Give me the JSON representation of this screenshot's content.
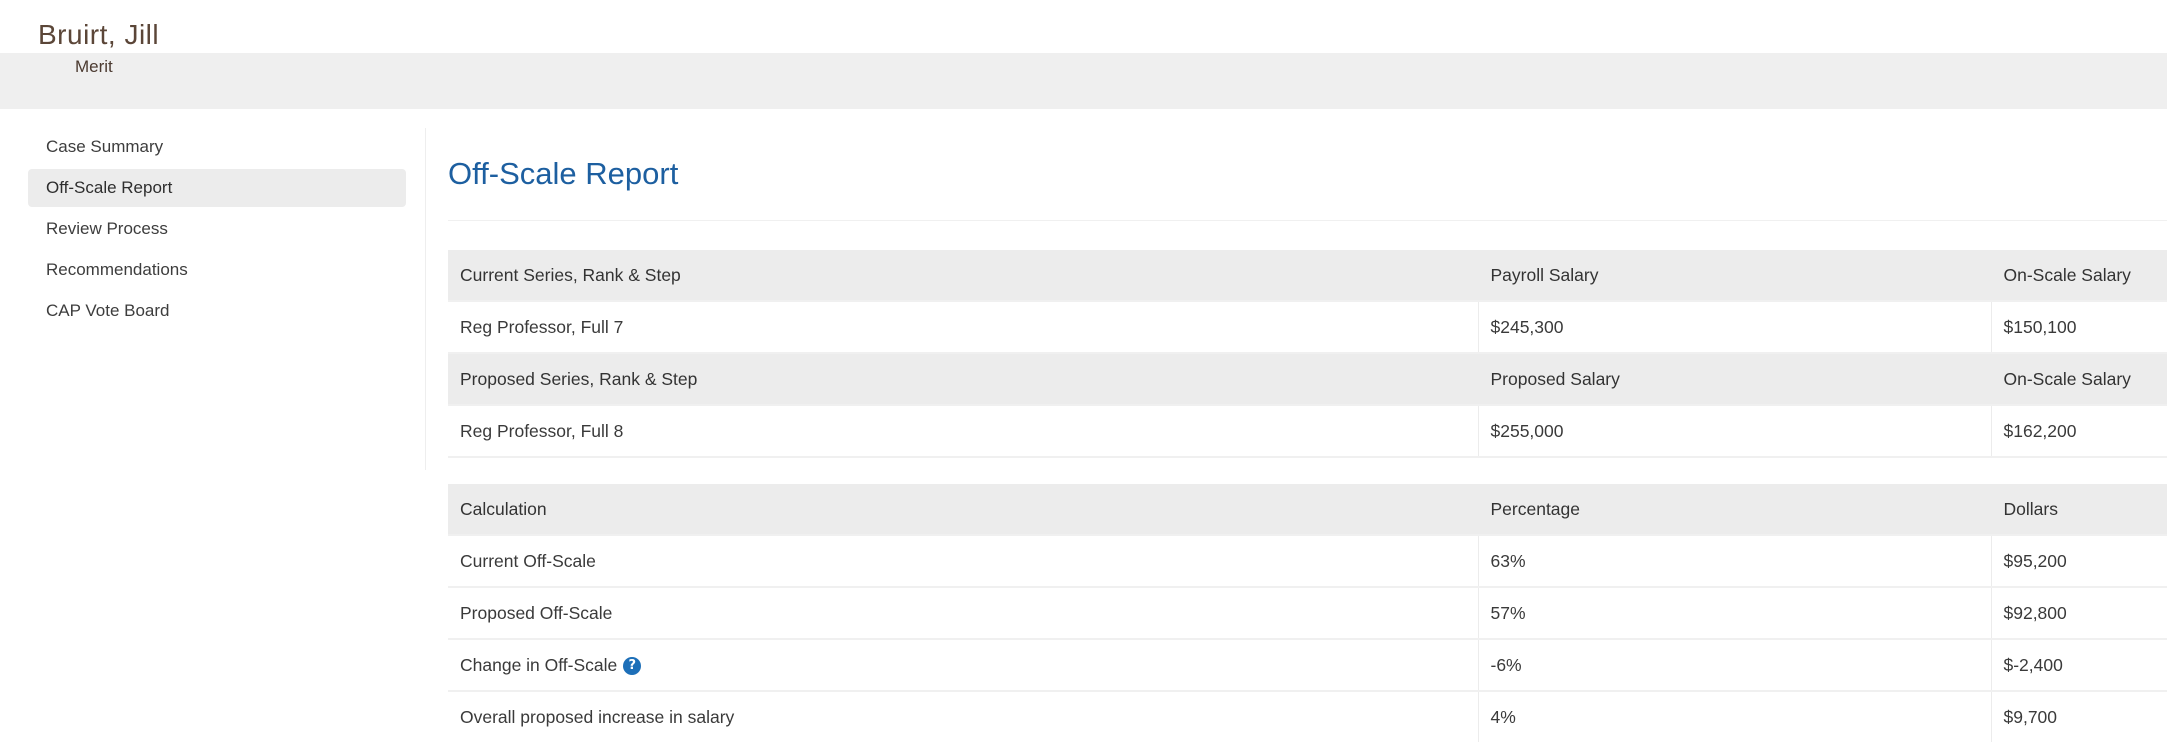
{
  "header": {
    "name": "Bruirt, Jill",
    "subtitle": "Merit"
  },
  "sidebar": {
    "items": [
      {
        "label": "Case Summary"
      },
      {
        "label": "Off-Scale Report"
      },
      {
        "label": "Review Process"
      },
      {
        "label": "Recommendations"
      },
      {
        "label": "CAP Vote Board"
      }
    ],
    "active_index": 1
  },
  "main": {
    "title": "Off-Scale Report",
    "series_table": {
      "current_header": [
        "Current Series, Rank & Step",
        "Payroll Salary",
        "On-Scale Salary"
      ],
      "current_row": [
        "Reg Professor, Full 7",
        "$245,300",
        "$150,100"
      ],
      "proposed_header": [
        "Proposed Series, Rank & Step",
        "Proposed Salary",
        "On-Scale Salary"
      ],
      "proposed_row": [
        "Reg Professor, Full 8",
        "$255,000",
        "$162,200"
      ]
    },
    "calc_table": {
      "header": [
        "Calculation",
        "Percentage",
        "Dollars"
      ],
      "rows": [
        [
          "Current Off-Scale",
          "63%",
          "$95,200"
        ],
        [
          "Proposed Off-Scale",
          "57%",
          "$92,800"
        ],
        [
          "Change in Off-Scale",
          "-6%",
          "$-2,400"
        ],
        [
          "Overall proposed increase in salary",
          "4%",
          "$9,700"
        ]
      ],
      "help_icon": "question-circle-icon"
    }
  },
  "colors": {
    "accent": "#1d5fa0",
    "header_band": "#efefef",
    "table_header": "#ececec",
    "name_text": "#5b4638"
  }
}
